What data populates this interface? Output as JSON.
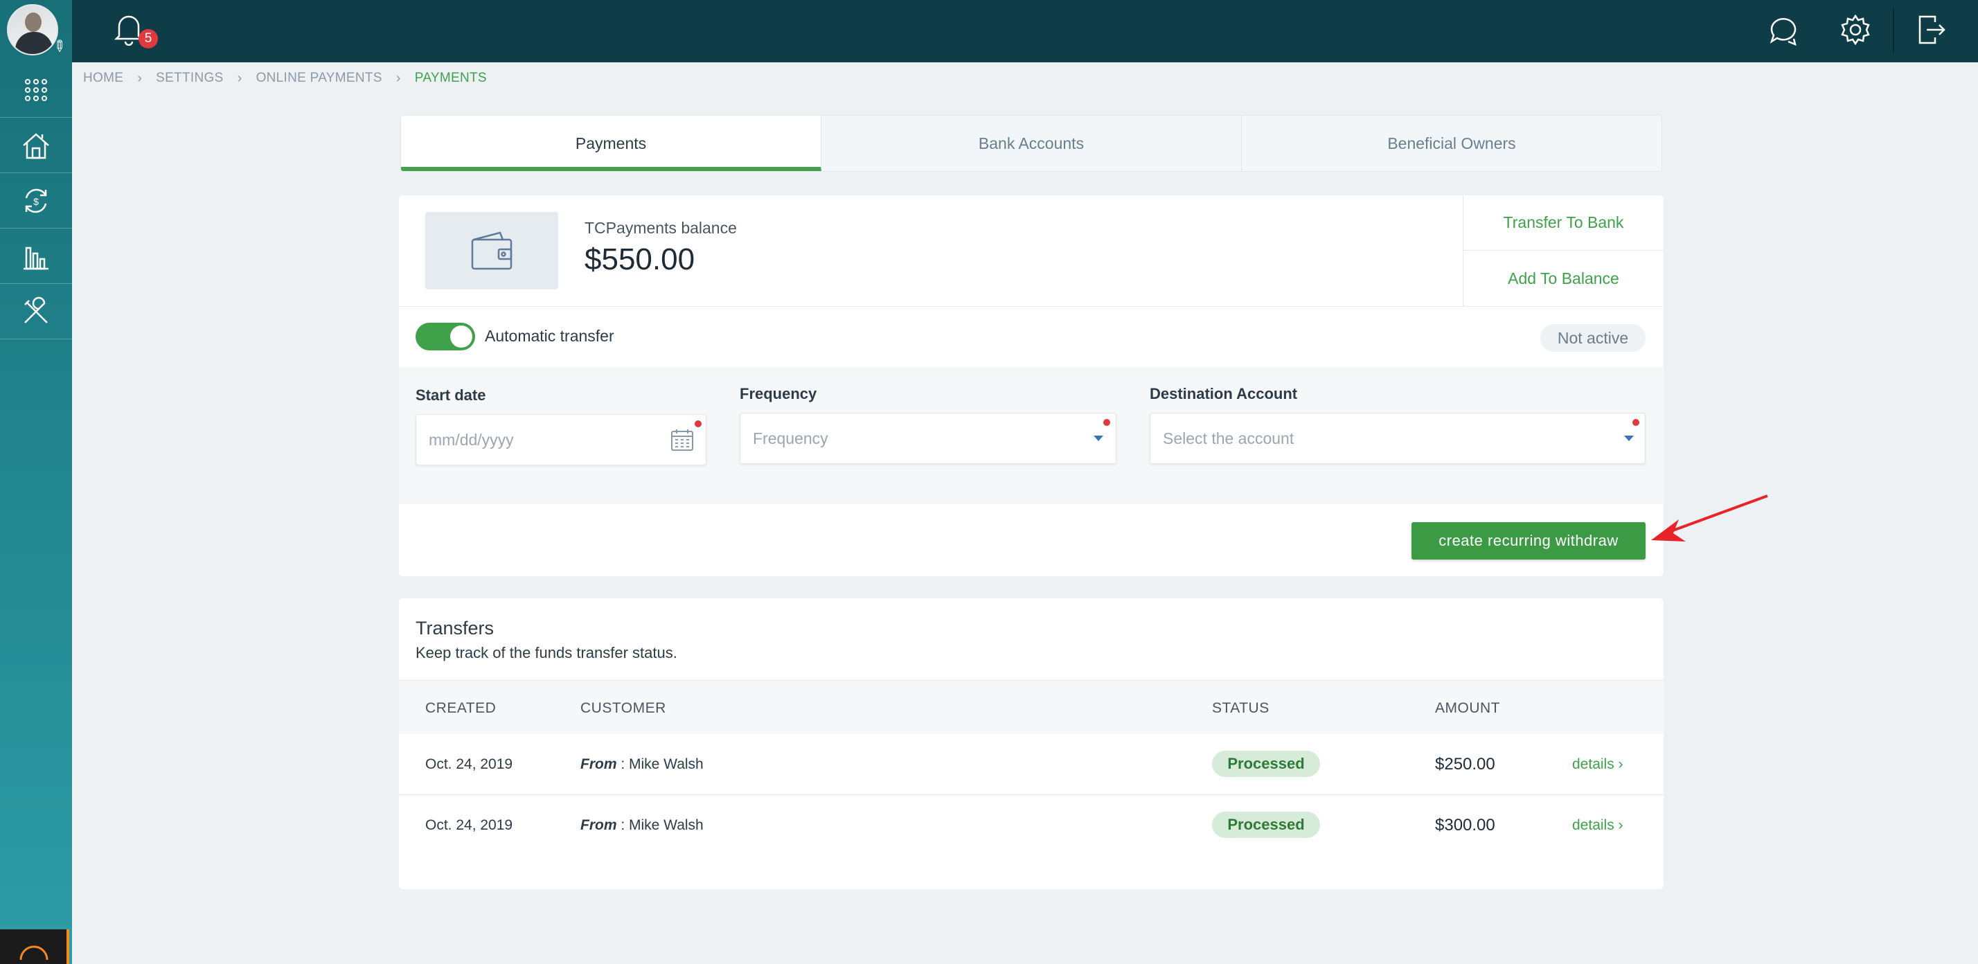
{
  "topbar": {
    "notifications_count": "5"
  },
  "sidebar": {
    "items": [
      {
        "icon": "apps-grid-icon"
      },
      {
        "icon": "house-icon"
      },
      {
        "icon": "money-exchange-icon"
      },
      {
        "icon": "bar-chart-icon"
      },
      {
        "icon": "tools-icon"
      }
    ]
  },
  "breadcrumb": [
    "HOME",
    "SETTINGS",
    "ONLINE PAYMENTS",
    "PAYMENTS"
  ],
  "tabs": [
    {
      "label": "Payments",
      "active": true
    },
    {
      "label": "Bank Accounts",
      "active": false
    },
    {
      "label": "Beneficial Owners",
      "active": false
    }
  ],
  "balance": {
    "label": "TCPayments balance",
    "amount": "$550.00",
    "transfer_label": "Transfer To Bank",
    "add_label": "Add To Balance"
  },
  "auto_transfer": {
    "label": "Automatic transfer",
    "enabled": true,
    "status": "Not active"
  },
  "form": {
    "start_date_label": "Start date",
    "start_date_placeholder": "mm/dd/yyyy",
    "frequency_label": "Frequency",
    "frequency_placeholder": "Frequency",
    "destination_label": "Destination Account",
    "destination_placeholder": "Select the account",
    "create_button": "create recurring withdraw"
  },
  "transfers": {
    "title": "Transfers",
    "subtitle": "Keep track of the funds transfer status.",
    "columns": [
      "CREATED",
      "CUSTOMER",
      "STATUS",
      "AMOUNT"
    ],
    "rows": [
      {
        "created": "Oct. 24, 2019",
        "from_label": "From",
        "customer": " : Mike Walsh",
        "status": "Processed",
        "amount": "$250.00",
        "details": "details"
      },
      {
        "created": "Oct. 24, 2019",
        "from_label": "From",
        "customer": " : Mike Walsh",
        "status": "Processed",
        "amount": "$300.00",
        "details": "details"
      }
    ]
  },
  "colors": {
    "accent_green": "#3fa14a",
    "topbar": "#0f3d47",
    "sidebar": "#1f8a94",
    "badge_red": "#e0393e"
  }
}
